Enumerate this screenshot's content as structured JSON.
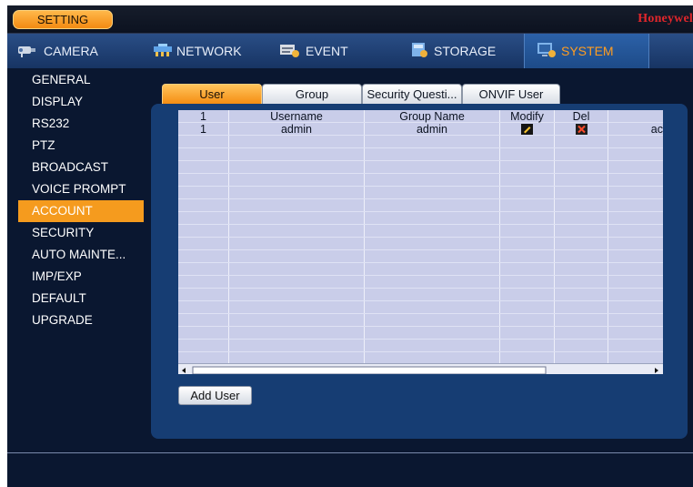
{
  "header": {
    "setting_label": "SETTING",
    "brand": "Honeywel"
  },
  "main_tabs": [
    {
      "label": "CAMERA",
      "icon": "camera-icon"
    },
    {
      "label": "NETWORK",
      "icon": "network-icon"
    },
    {
      "label": "EVENT",
      "icon": "event-icon"
    },
    {
      "label": "STORAGE",
      "icon": "storage-icon"
    },
    {
      "label": "SYSTEM",
      "icon": "system-icon",
      "active": true
    }
  ],
  "sidebar": {
    "items": [
      {
        "label": "GENERAL"
      },
      {
        "label": "DISPLAY"
      },
      {
        "label": "RS232"
      },
      {
        "label": "PTZ"
      },
      {
        "label": "BROADCAST"
      },
      {
        "label": "VOICE PROMPT"
      },
      {
        "label": "ACCOUNT",
        "active": true
      },
      {
        "label": "SECURITY"
      },
      {
        "label": "AUTO MAINTE..."
      },
      {
        "label": "IMP/EXP"
      },
      {
        "label": "DEFAULT"
      },
      {
        "label": "UPGRADE"
      }
    ]
  },
  "sub_tabs": [
    {
      "label": "User",
      "active": true
    },
    {
      "label": "Group"
    },
    {
      "label": "Security Questi..."
    },
    {
      "label": "ONVIF User"
    }
  ],
  "table": {
    "headers": [
      "1",
      "Username",
      "Group Name",
      "Modify",
      "Del",
      ""
    ],
    "rows": [
      {
        "index": "1",
        "username": "admin",
        "group": "admin",
        "modify": "edit-icon",
        "del": "delete-icon",
        "extra": "ac"
      }
    ]
  },
  "actions": {
    "add_user_label": "Add User"
  },
  "colors": {
    "accent": "#f59b1e",
    "panel": "#163d73",
    "table_bg": "#c9cde9",
    "brand": "#e0262b"
  }
}
